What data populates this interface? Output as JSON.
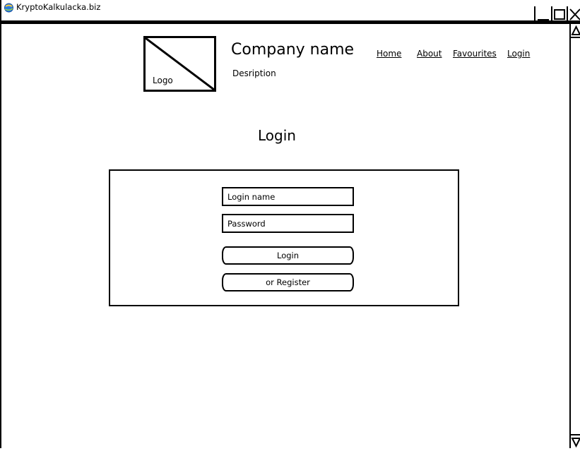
{
  "window": {
    "title": "KryptoKalkulacka.biz"
  },
  "header": {
    "logo_label": "Logo",
    "company_name": "Company name",
    "description": "Desription"
  },
  "nav": {
    "home": "Home",
    "about": "About",
    "favourites": "Favourites",
    "login": "Login"
  },
  "main": {
    "heading": "Login",
    "form": {
      "login_placeholder": "Login name",
      "password_placeholder": "Password",
      "login_button": "Login",
      "register_button": "or Register"
    }
  },
  "icons": {
    "app": "browser-globe-icon",
    "minimize": "minimize-icon",
    "maximize": "maximize-icon",
    "close": "close-icon"
  }
}
